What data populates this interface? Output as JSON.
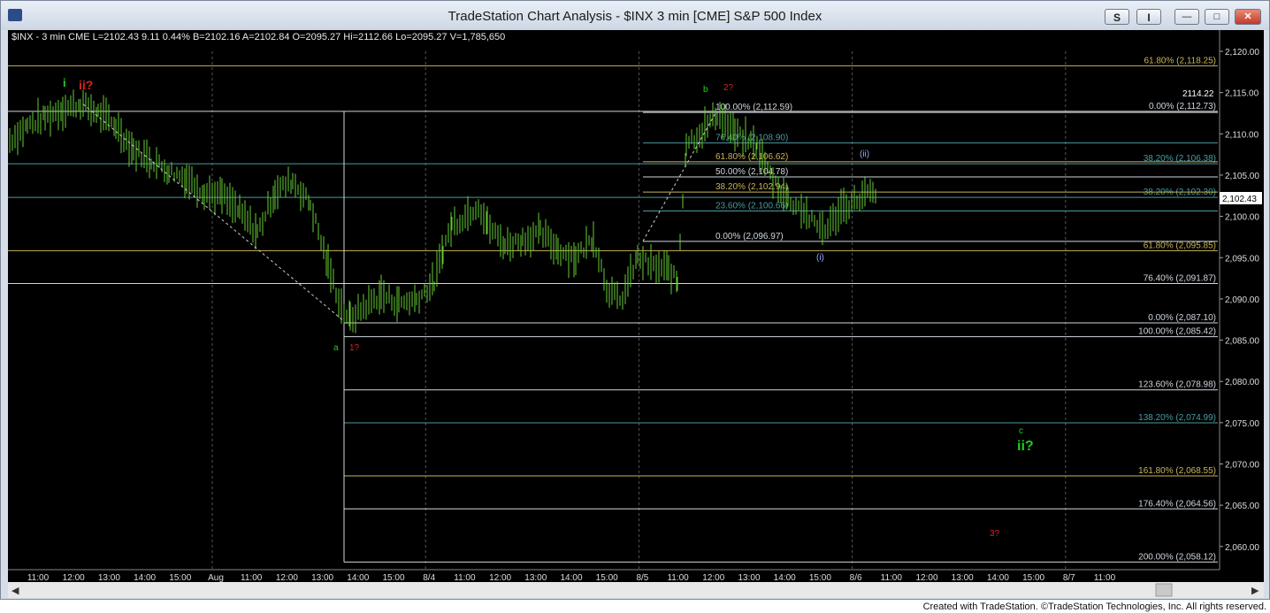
{
  "window": {
    "title": "TradeStation Chart Analysis - $INX 3 min [CME] S&P 500 Index",
    "btn_s": "S",
    "btn_i": "I",
    "minimize": "—",
    "restore": "□",
    "close": "✕"
  },
  "colors": {
    "background": "#000000",
    "price_bars": "#66cc33",
    "axis_text": "#dddddd",
    "fib_teal": "#4a9aa0",
    "fib_gold": "#c8b45a",
    "wave_green": "#22cc22",
    "wave_red": "#dd2222",
    "wave_blue": "#8fa8ff"
  },
  "status": {
    "text": "$INX - 3 min  CME  L=2102.43  9.11   0.44%  B=2102.16  A=2102.84  O=2095.27  Hi=2112.66  Lo=2095.27  V=1,785,650"
  },
  "price_axis": {
    "ticks": [
      {
        "label": "2,120.00",
        "value": 2120
      },
      {
        "label": "2,115.00",
        "value": 2115
      },
      {
        "label": "2,110.00",
        "value": 2110
      },
      {
        "label": "2,105.00",
        "value": 2105
      },
      {
        "label": "2,100.00",
        "value": 2100
      },
      {
        "label": "2,095.00",
        "value": 2095
      },
      {
        "label": "2,090.00",
        "value": 2090
      },
      {
        "label": "2,085.00",
        "value": 2085
      },
      {
        "label": "2,080.00",
        "value": 2080
      },
      {
        "label": "2,075.00",
        "value": 2075
      },
      {
        "label": "2,070.00",
        "value": 2070
      },
      {
        "label": "2,065.00",
        "value": 2065
      },
      {
        "label": "2,060.00",
        "value": 2060
      }
    ],
    "last_price": "2,102.43",
    "marker_2114": "2114.22"
  },
  "time_axis": {
    "labels": [
      "11:00",
      "12:00",
      "13:00",
      "14:00",
      "15:00",
      "Aug",
      "11:00",
      "12:00",
      "13:00",
      "14:00",
      "15:00",
      "8/4",
      "11:00",
      "12:00",
      "13:00",
      "14:00",
      "15:00",
      "8/5",
      "11:00",
      "12:00",
      "13:00",
      "14:00",
      "15:00",
      "8/6",
      "11:00",
      "12:00",
      "13:00",
      "14:00",
      "15:00",
      "8/7",
      "11:00"
    ]
  },
  "fib_right": [
    {
      "label": "61.80% (2,118.25)",
      "value": 2118.25,
      "color": "gold"
    },
    {
      "label": "0.00% (2,112.73)",
      "value": 2112.73,
      "color": "white"
    },
    {
      "label": "38.20% (2,106.38)",
      "value": 2106.38,
      "color": "teal"
    },
    {
      "label": "38.20% (2,102.30)",
      "value": 2102.3,
      "color": "teal"
    },
    {
      "label": "61.80% (2,095.85)",
      "value": 2095.85,
      "color": "gold"
    },
    {
      "label": "76.40% (2,091.87)",
      "value": 2091.87,
      "color": "white"
    },
    {
      "label": "0.00% (2,087.10)",
      "value": 2087.1,
      "color": "white"
    },
    {
      "label": "100.00% (2,085.42)",
      "value": 2085.42,
      "color": "white"
    },
    {
      "label": "123.60% (2,078.98)",
      "value": 2078.98,
      "color": "white"
    },
    {
      "label": "138.20% (2,074.99)",
      "value": 2074.99,
      "color": "teal"
    },
    {
      "label": "161.80% (2,068.55)",
      "value": 2068.55,
      "color": "gold"
    },
    {
      "label": "176.40% (2,064.56)",
      "value": 2064.56,
      "color": "white"
    },
    {
      "label": "200.00% (2,058.12)",
      "value": 2058.12,
      "color": "white"
    }
  ],
  "fib_mid": [
    {
      "label": "100.00% (2,112.59)",
      "value": 2112.59,
      "color": "white"
    },
    {
      "label": "76.40% (2,108.90)",
      "value": 2108.9,
      "color": "teal"
    },
    {
      "label": "61.80% (2,106.62)",
      "value": 2106.62,
      "color": "gold"
    },
    {
      "label": "50.00% (2,104.78)",
      "value": 2104.78,
      "color": "white"
    },
    {
      "label": "38.20% (2,102.94)",
      "value": 2102.94,
      "color": "gold"
    },
    {
      "label": "23.60% (2,100.66)",
      "value": 2100.66,
      "color": "teal"
    },
    {
      "label": "0.00% (2,096.97)",
      "value": 2096.97,
      "color": "white"
    }
  ],
  "wave_labels": {
    "i": "i",
    "ii_q": "ii?",
    "a": "a",
    "one_q": "1?",
    "b": "b",
    "two_q": "2?",
    "paren_i": "(i)",
    "paren_ii": "(ii)",
    "c": "c",
    "ii_q_big": "ii?",
    "three_q": "3?"
  },
  "footer": "Created with TradeStation. ©TradeStation Technologies, Inc. All rights reserved."
}
